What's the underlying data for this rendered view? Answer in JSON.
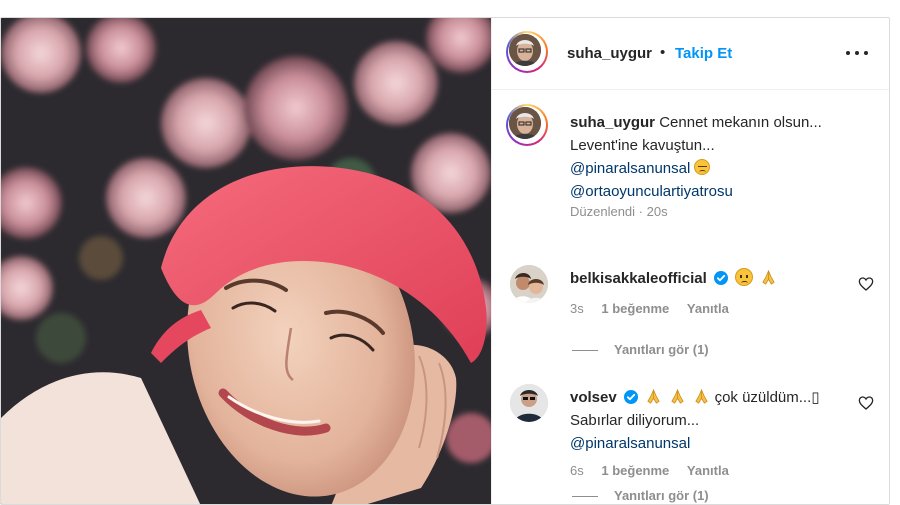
{
  "post": {
    "username": "suha_uygur",
    "separator": "•",
    "follow_label": "Takip Et",
    "more_icon": "more-horizontal-icon"
  },
  "caption": {
    "username": "suha_uygur",
    "line1": "Cennet mekanın olsun...",
    "line2": "Levent'ine kavuştun...",
    "mention1": "@pinaralsanunsal",
    "mention2": "@ortaoyunculartiyatrosu",
    "edited_label": "Düzenlendi",
    "dot": "·",
    "time": "20s"
  },
  "comments": [
    {
      "username": "belkisakkaleofficial",
      "verified": true,
      "text": "",
      "time": "3s",
      "likes": "1 beğenme",
      "reply_label": "Yanıtla",
      "view_replies": "Yanıtları gör (1)"
    },
    {
      "username": "volsev",
      "verified": true,
      "text": "çok üzüldüm...▯",
      "line2": "Sabırlar diliyorum...",
      "mention": "@pinaralsanunsal",
      "time": "6s",
      "likes": "1 beğenme",
      "reply_label": "Yanıtla",
      "view_replies": "Yanıtları gör (1)"
    }
  ],
  "colors": {
    "follow_blue": "#0095f6",
    "mention_blue": "#00376b",
    "meta_gray": "#8e8e8e",
    "scarf_pink": "#ee5a6e"
  }
}
